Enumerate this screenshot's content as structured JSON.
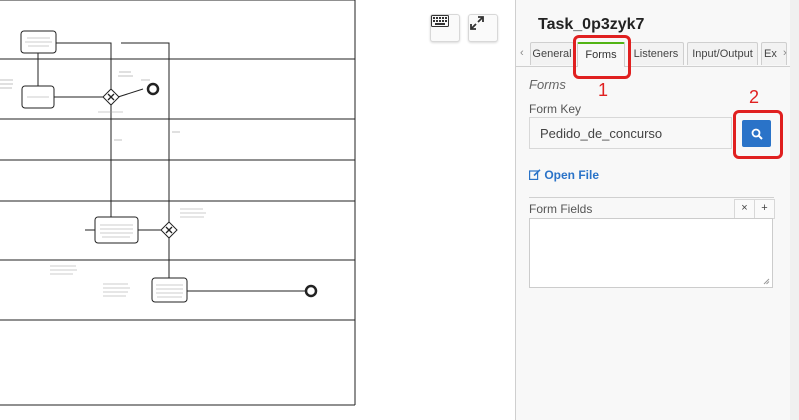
{
  "panel": {
    "title": "Task_0p3zyk7",
    "tabs": [
      {
        "label": "General",
        "active": false
      },
      {
        "label": "Forms",
        "active": true
      },
      {
        "label": "Listeners",
        "active": false
      },
      {
        "label": "Input/Output",
        "active": false
      },
      {
        "label": "Ex",
        "active": false
      }
    ],
    "section_title": "Forms",
    "form_key_label": "Form Key",
    "form_key_value": "Pedido_de_concurso",
    "open_file_label": "Open File",
    "form_fields_label": "Form Fields",
    "clear_label": "×",
    "add_label": "+"
  },
  "annotations": {
    "step1": "1",
    "step2": "2"
  },
  "colors": {
    "accent": "#2a73c8",
    "active_tab": "#52b415",
    "annotation": "#e02020"
  },
  "icons": [
    "keyboard-icon",
    "fullscreen-icon",
    "search-icon",
    "edit-icon",
    "resize-handle-icon"
  ]
}
